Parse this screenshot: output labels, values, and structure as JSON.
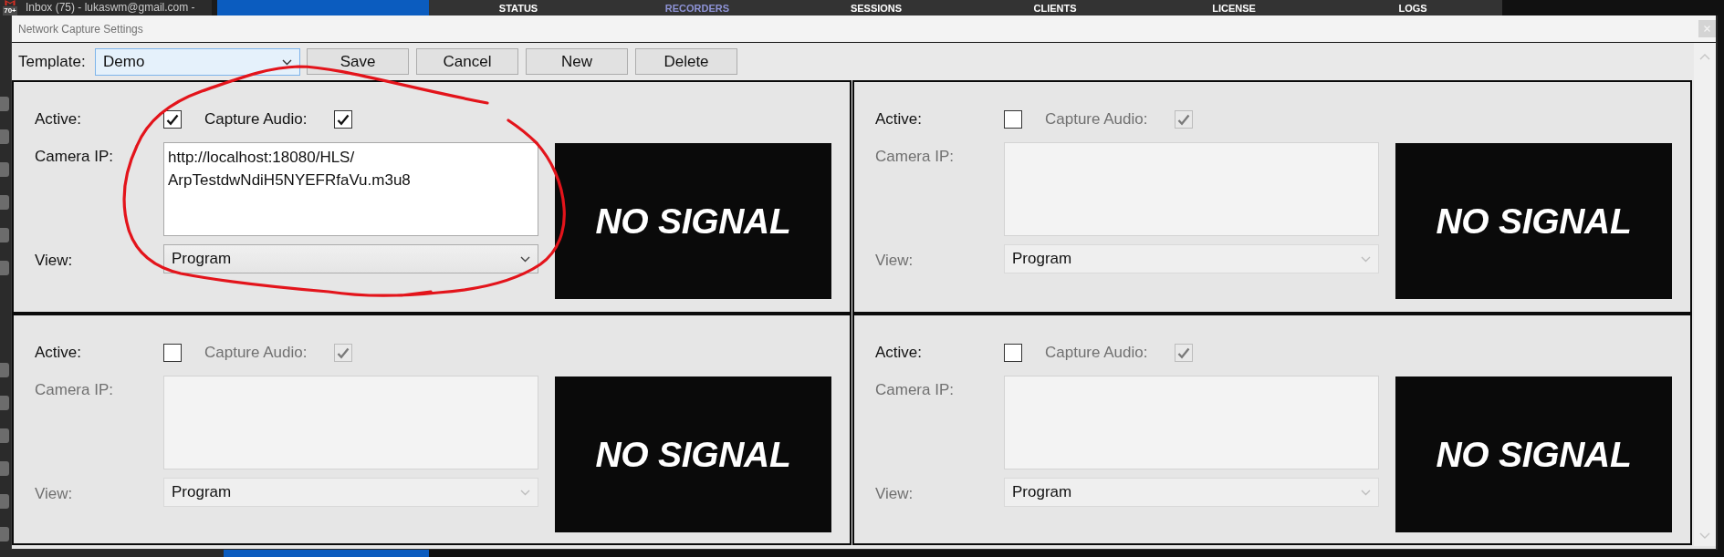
{
  "background_app": {
    "mail_tab": {
      "badge": "70+",
      "title": "Inbox (75) - lukaswm@gmail.com -"
    },
    "nav_tabs": [
      {
        "label": "STATUS",
        "selected": false
      },
      {
        "label": "RECORDERS",
        "selected": true
      },
      {
        "label": "SESSIONS",
        "selected": false
      },
      {
        "label": "CLIENTS",
        "selected": false
      },
      {
        "label": "LICENSE",
        "selected": false
      },
      {
        "label": "LOGS",
        "selected": false
      }
    ]
  },
  "window": {
    "title": "Network Capture Settings"
  },
  "toolbar": {
    "template_label": "Template:",
    "template": {
      "value": "Demo"
    },
    "buttons": [
      "Save",
      "Cancel",
      "New",
      "Delete"
    ]
  },
  "panels": [
    {
      "active": {
        "label": "Active:",
        "checked": true
      },
      "capture_audio": {
        "label": "Capture Audio:",
        "checked": true,
        "disabled": false
      },
      "camera_ip": {
        "label": "Camera IP:",
        "value": "http://localhost:18080/HLS/ArpTestdwNdiH5NYEFRfaVu.m3u8",
        "disabled": false
      },
      "view": {
        "label": "View:",
        "value": "Program",
        "disabled": false
      },
      "preview": {
        "text": "NO SIGNAL"
      }
    },
    {
      "active": {
        "label": "Active:",
        "checked": false
      },
      "capture_audio": {
        "label": "Capture Audio:",
        "checked": true,
        "disabled": true
      },
      "camera_ip": {
        "label": "Camera IP:",
        "disabled": true
      },
      "view": {
        "label": "View:",
        "value": "Program",
        "disabled": true
      },
      "preview": {
        "text": "NO SIGNAL"
      }
    },
    {
      "active": {
        "label": "Active:",
        "checked": false
      },
      "capture_audio": {
        "label": "Capture Audio:",
        "checked": true,
        "disabled": true
      },
      "camera_ip": {
        "label": "Camera IP:",
        "disabled": true
      },
      "view": {
        "label": "View:",
        "value": "Program",
        "disabled": true
      },
      "preview": {
        "text": "NO SIGNAL"
      }
    },
    {
      "active": {
        "label": "Active:",
        "checked": false
      },
      "capture_audio": {
        "label": "Capture Audio:",
        "checked": true,
        "disabled": true
      },
      "camera_ip": {
        "label": "Camera IP:",
        "disabled": true
      },
      "view": {
        "label": "View:",
        "value": "Program",
        "disabled": true
      },
      "preview": {
        "text": "NO SIGNAL"
      }
    }
  ]
}
